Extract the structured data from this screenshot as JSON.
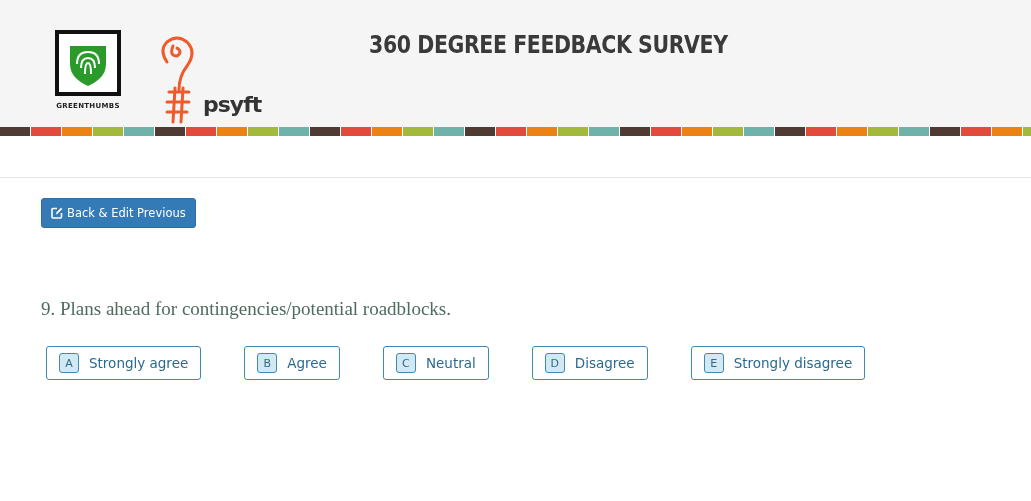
{
  "header": {
    "logos": [
      {
        "kind": "greenthumbs",
        "label": "GREENTHUMBS"
      },
      {
        "kind": "psyft",
        "label": "psyft"
      }
    ],
    "title": "360 DEGREE FEEDBACK SURVEY"
  },
  "back_button": {
    "label": "Back & Edit Previous"
  },
  "question": {
    "text": "9. Plans ahead for contingencies/potential roadblocks.",
    "options": [
      {
        "key": "A",
        "label": "Strongly agree"
      },
      {
        "key": "B",
        "label": "Agree"
      },
      {
        "key": "C",
        "label": "Neutral"
      },
      {
        "key": "D",
        "label": "Disagree"
      },
      {
        "key": "E",
        "label": "Strongly disagree"
      }
    ]
  }
}
